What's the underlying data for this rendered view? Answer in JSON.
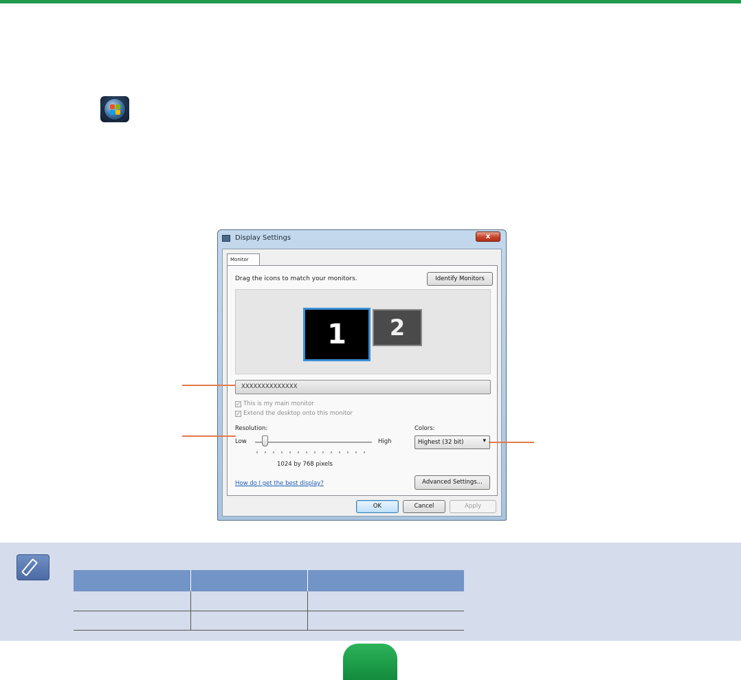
{
  "dialog": {
    "title": "Display Settings",
    "close_glyph": "x",
    "tab_label": "Monitor",
    "drag_hint": "Drag the icons to match your monitors.",
    "identify_button": "Identify Monitors",
    "monitors": [
      {
        "label": "1",
        "selected": true
      },
      {
        "label": "2",
        "selected": false
      }
    ],
    "monitor_name": "XXXXXXXXXXXXXX",
    "checkbox_main": {
      "label": "This is my main monitor",
      "checked": true,
      "enabled": false
    },
    "checkbox_extend": {
      "label": "Extend the desktop onto this monitor",
      "checked": true,
      "enabled": false
    },
    "resolution_label": "Resolution:",
    "low_label": "Low",
    "high_label": "High",
    "resolution_value": "1024 by 768 pixels",
    "colors_label": "Colors:",
    "colors_value": "Highest (32 bit)",
    "help_link": "How do I get the best display?",
    "advanced_button": "Advanced Settings...",
    "ok_button": "OK",
    "cancel_button": "Cancel",
    "apply_button": "Apply"
  },
  "colors": {
    "accent_green": "#1e9a4a",
    "callout_orange": "#e07a4a",
    "note_background": "#d5dceb",
    "table_header": "#7394c6"
  },
  "note": {
    "icon": "note-pencil-icon"
  }
}
